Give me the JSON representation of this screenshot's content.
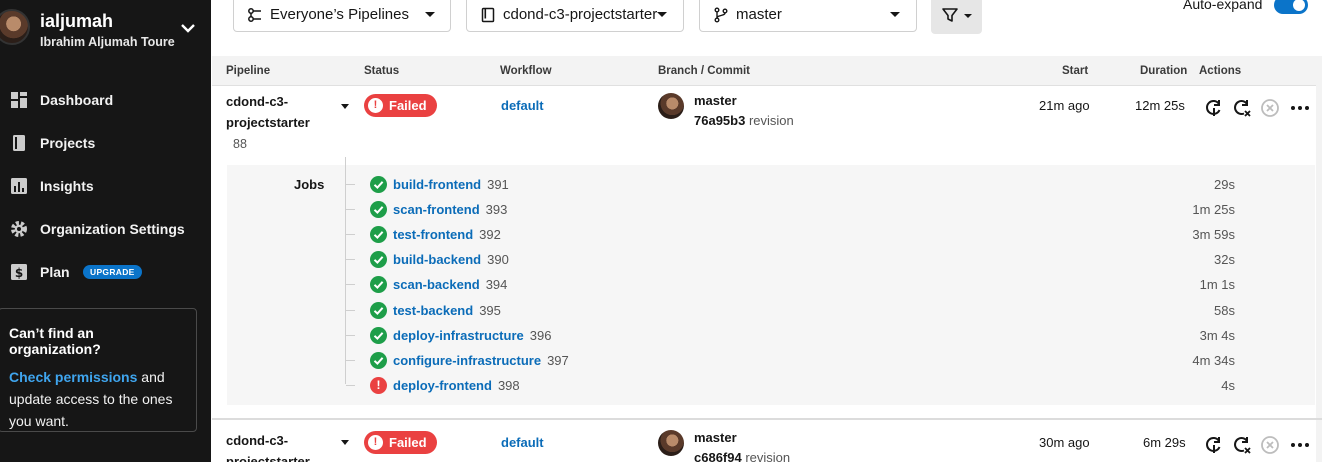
{
  "user": {
    "handle": "ialjumah",
    "full_name": "Ibrahim Aljumah Toure"
  },
  "sidebar": {
    "items": [
      {
        "label": "Dashboard",
        "icon": "dashboard-icon"
      },
      {
        "label": "Projects",
        "icon": "projects-icon"
      },
      {
        "label": "Insights",
        "icon": "insights-icon"
      },
      {
        "label": "Organization Settings",
        "icon": "gear-icon"
      },
      {
        "label": "Plan",
        "icon": "dollar-icon",
        "badge": "UPGRADE"
      }
    ],
    "org_box": {
      "title": "Can’t find an organization?",
      "link": "Check permissions",
      "text": " and update access to the ones you want."
    }
  },
  "filters": {
    "pipelines": "Everyone’s Pipelines",
    "project": "cdond-c3-projectstarter",
    "branch": "master",
    "auto_expand_label": "Auto-expand"
  },
  "table": {
    "headers": [
      "Pipeline",
      "Status",
      "Workflow",
      "Branch / Commit",
      "Start",
      "Duration",
      "Actions"
    ],
    "jobs_label": "Jobs",
    "rows": [
      {
        "pipeline_line1": "cdond-c3-",
        "pipeline_line2": "projectstarter",
        "number": "88",
        "status": "Failed",
        "workflow": "default",
        "branch": "master",
        "commit": "76a95b3",
        "revision_label": "revision",
        "start": "21m ago",
        "duration": "12m 25s",
        "jobs": [
          {
            "name": "build-frontend",
            "num": "391",
            "duration": "29s",
            "status": "success"
          },
          {
            "name": "scan-frontend",
            "num": "393",
            "duration": "1m 25s",
            "status": "success"
          },
          {
            "name": "test-frontend",
            "num": "392",
            "duration": "3m 59s",
            "status": "success"
          },
          {
            "name": "build-backend",
            "num": "390",
            "duration": "32s",
            "status": "success"
          },
          {
            "name": "scan-backend",
            "num": "394",
            "duration": "1m 1s",
            "status": "success"
          },
          {
            "name": "test-backend",
            "num": "395",
            "duration": "58s",
            "status": "success"
          },
          {
            "name": "deploy-infrastructure",
            "num": "396",
            "duration": "3m 4s",
            "status": "success"
          },
          {
            "name": "configure-infrastructure",
            "num": "397",
            "duration": "4m 34s",
            "status": "success"
          },
          {
            "name": "deploy-frontend",
            "num": "398",
            "duration": "4s",
            "status": "failed"
          }
        ]
      },
      {
        "pipeline_line1": "cdond-c3-",
        "pipeline_line2": "projectstarter",
        "status": "Failed",
        "workflow": "default",
        "branch": "master",
        "commit": "c686f94",
        "revision_label": "revision",
        "start": "30m ago",
        "duration": "6m 29s"
      }
    ]
  },
  "colors": {
    "accent": "#0b74c9",
    "failed": "#ea4141",
    "success": "#1e9e49",
    "sidebar": "#161616"
  }
}
